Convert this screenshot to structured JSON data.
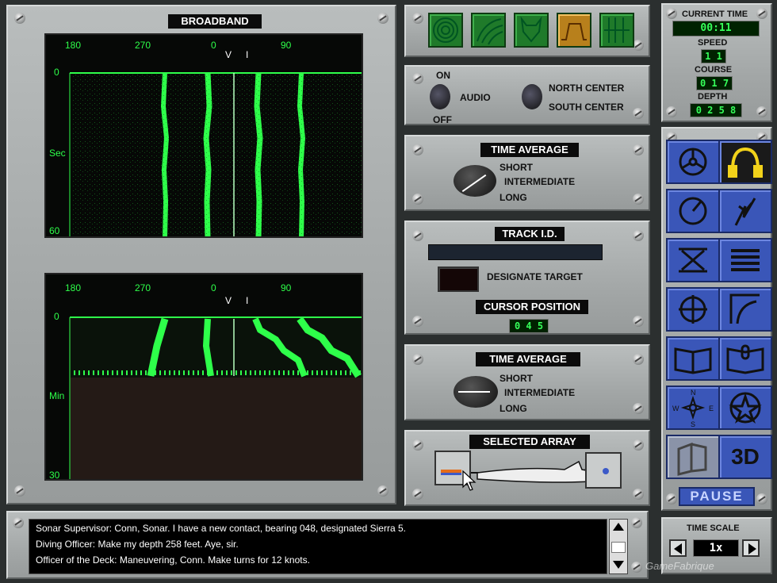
{
  "broadband": {
    "title": "BROADBAND",
    "top_ticks": [
      "180",
      "270",
      "0",
      "V",
      "I",
      "90"
    ],
    "top_y_labels": [
      "0",
      "Sec",
      "60"
    ],
    "bottom_ticks": [
      "180",
      "270",
      "0",
      "V",
      "I",
      "90"
    ],
    "bottom_y_labels": [
      "0",
      "Min",
      "30"
    ]
  },
  "status": {
    "current_time_label": "CURRENT TIME",
    "current_time": "00:11",
    "speed_label": "SPEED",
    "speed": "1 1",
    "course_label": "COURSE",
    "course": "0 1 7",
    "depth_label": "DEPTH",
    "depth": "0 2 5 8"
  },
  "top_buttons": [
    {
      "icon": "concentric-circles-icon"
    },
    {
      "icon": "curve-waves-icon"
    },
    {
      "icon": "devil-face-icon"
    },
    {
      "icon": "spectrum-icon"
    },
    {
      "icon": "waterfall-lines-icon"
    }
  ],
  "audio": {
    "on": "ON",
    "off": "OFF",
    "audio": "AUDIO",
    "north": "NORTH CENTER",
    "south": "SOUTH CENTER"
  },
  "time_average_1": {
    "title": "TIME AVERAGE",
    "short": "SHORT",
    "intermediate": "INTERMEDIATE",
    "long": "LONG"
  },
  "track": {
    "title": "TRACK I.D.",
    "designate": "DESIGNATE TARGET",
    "cursor_title": "CURSOR POSITION",
    "cursor_value": "0 4 5"
  },
  "time_average_2": {
    "title": "TIME AVERAGE",
    "short": "SHORT",
    "intermediate": "INTERMEDIATE",
    "long": "LONG"
  },
  "array": {
    "title": "SELECTED ARRAY"
  },
  "stations": [
    {
      "icon": "helm-wheel-icon"
    },
    {
      "icon": "headphones-icon",
      "active": true
    },
    {
      "icon": "radar-dial-icon"
    },
    {
      "icon": "periscope-flash-icon"
    },
    {
      "icon": "weapons-cross-icon"
    },
    {
      "icon": "list-lines-icon"
    },
    {
      "icon": "crosshair-icon"
    },
    {
      "icon": "curve-plot-icon"
    },
    {
      "icon": "open-book-icon"
    },
    {
      "icon": "book-microphone-icon"
    },
    {
      "icon": "compass-rose-icon"
    },
    {
      "icon": "star-badge-icon"
    },
    {
      "icon": "map-3d-icon"
    },
    {
      "icon": "view-3d-icon",
      "label": "3D"
    }
  ],
  "pause": "PAUSE",
  "timescale": {
    "label": "TIME SCALE",
    "value": "1x"
  },
  "messages": [
    "Sonar Supervisor:  Conn, Sonar.  I have a new contact, bearing 048, designated Sierra 5.",
    "Diving Officer:  Make my depth 258 feet.  Aye, sir.",
    "Officer of the Deck:  Maneuvering, Conn.  Make turns for 12 knots."
  ],
  "watermark": "GameFabrique"
}
